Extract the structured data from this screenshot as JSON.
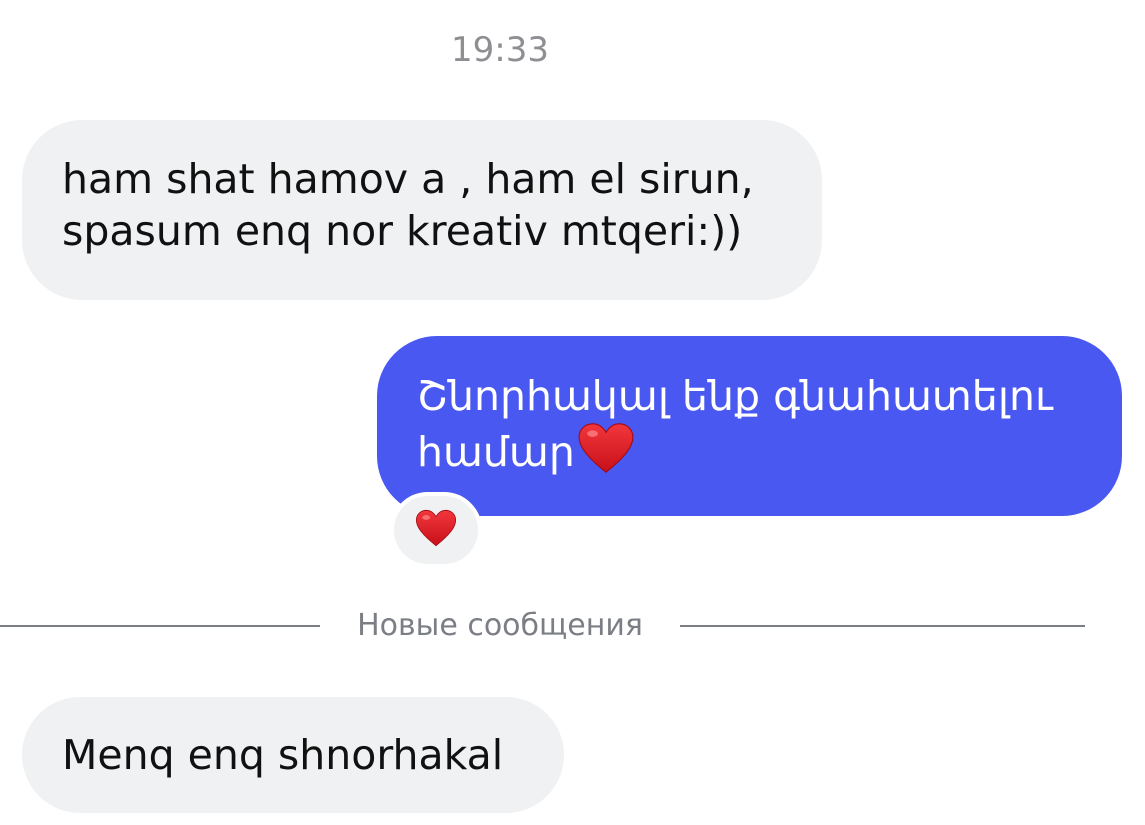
{
  "chat": {
    "timestamp": "19:33",
    "messages": [
      {
        "direction": "incoming",
        "lines": [
          "ham shat hamov a , ham el sirun,",
          "spasum enq nor kreativ mtqeri:))"
        ]
      },
      {
        "direction": "outgoing",
        "lines": [
          "Շնորհակալ ենք գնահատելու",
          "համար"
        ],
        "trailing_emoji": "red-heart-emoji",
        "reaction": "red-heart-emoji"
      },
      {
        "direction": "incoming",
        "lines": [
          "Menq enq shnorhakal"
        ]
      }
    ],
    "new_messages_divider": "Новые сообщения"
  },
  "colors": {
    "incoming_bubble": "#eff1f2",
    "outgoing_bubble": "#4a58f2",
    "heart": "#e3161f",
    "divider": "#7b7f85"
  }
}
